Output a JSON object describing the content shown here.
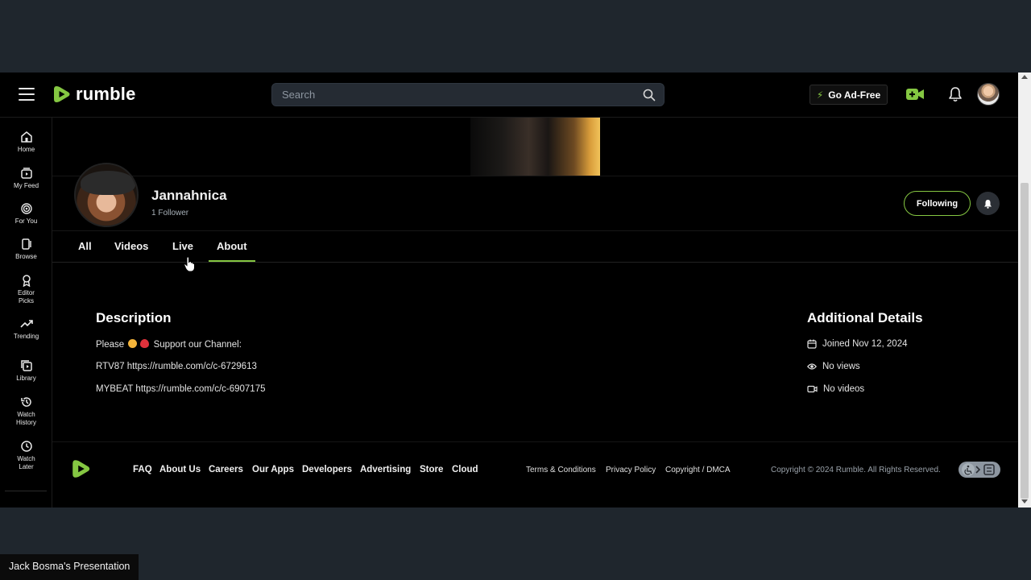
{
  "header": {
    "logo_text": "rumble",
    "search_placeholder": "Search",
    "go_adfree_label": "Go Ad-Free",
    "accent_color": "#85c742"
  },
  "sidebar": {
    "items": [
      {
        "label": "Home",
        "icon": "home-icon"
      },
      {
        "label": "My Feed",
        "icon": "feed-icon"
      },
      {
        "label": "For You",
        "icon": "target-icon"
      },
      {
        "label": "Browse",
        "icon": "browse-icon"
      },
      {
        "label": "Editor Picks",
        "icon": "ribbon-icon"
      },
      {
        "label": "Trending",
        "icon": "trending-icon"
      },
      {
        "label": "Library",
        "icon": "library-icon"
      },
      {
        "label": "Watch History",
        "icon": "history-icon"
      },
      {
        "label": "Watch Later",
        "icon": "clock-icon"
      }
    ]
  },
  "channel": {
    "name": "Jannahnica",
    "followers": "1 Follower",
    "following_label": "Following"
  },
  "tabs": [
    {
      "label": "All",
      "active": false
    },
    {
      "label": "Videos",
      "active": false
    },
    {
      "label": "Live",
      "active": false
    },
    {
      "label": "About",
      "active": true
    }
  ],
  "about": {
    "description_title": "Description",
    "line1_a": "Please",
    "line1_b": "Support our Channel:",
    "line2": "RTV87 https://rumble.com/c/c-6729613",
    "line3": "MYBEAT https://rumble.com/c/c-6907175",
    "details_title": "Additional Details",
    "joined": "Joined Nov 12, 2024",
    "views": "No views",
    "videos": "No videos"
  },
  "footer": {
    "links": [
      "FAQ",
      "About Us",
      "Careers",
      "Our Apps",
      "Developers",
      "Advertising",
      "Store",
      "Cloud"
    ],
    "legal": [
      "Terms & Conditions",
      "Privacy Policy",
      "Copyright / DMCA"
    ],
    "copyright": "Copyright © 2024 Rumble. All Rights Reserved."
  },
  "presenter_label": "Jack Bosma's Presentation"
}
